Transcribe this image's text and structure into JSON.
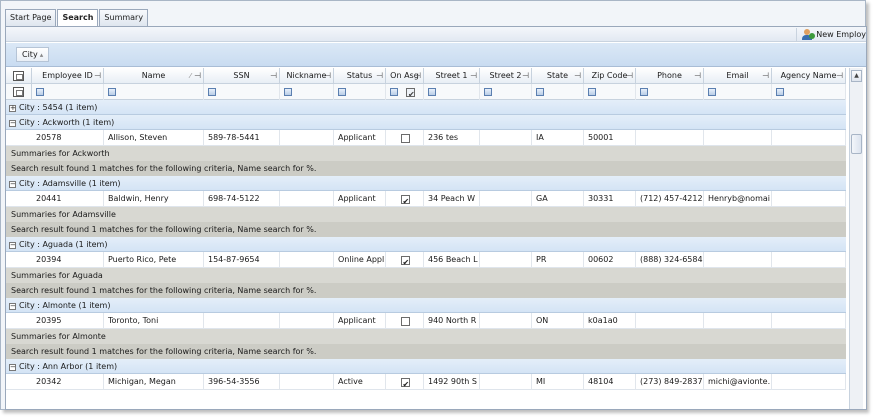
{
  "tabs": [
    {
      "label": "Start Page"
    },
    {
      "label": "Search"
    },
    {
      "label": "Summary"
    }
  ],
  "toolbar": {
    "new_employee_label": "New Employ"
  },
  "grouping": {
    "chip_label": "City",
    "sort_glyph": "▴"
  },
  "columns": {
    "employee_id": "Employee ID",
    "name": "Name",
    "ssn": "SSN",
    "nickname": "Nickname",
    "status": "Status",
    "on_asg": "On Asg",
    "street1": "Street 1",
    "street2": "Street 2",
    "state": "State",
    "zip": "Zip Code",
    "phone": "Phone",
    "email": "Email",
    "agency": "Agency Name"
  },
  "collapsed_group": {
    "label": "City : 5454 (1 item)"
  },
  "groups": [
    {
      "label": "City : Ackworth (1 item)",
      "row": {
        "employee_id": "20578",
        "name": "Allison, Steven",
        "ssn": "589-78-5441",
        "nickname": "",
        "status": "Applicant",
        "on_asg": false,
        "street1": "236 tes",
        "street2": "",
        "state": "IA",
        "zip": "50001",
        "phone": "",
        "email": "",
        "agency": ""
      },
      "summary_title": "Summaries for Ackworth",
      "summary_text": "Search result found 1 matches for the following criteria, Name search for %."
    },
    {
      "label": "City : Adamsville (1 item)",
      "row": {
        "employee_id": "20441",
        "name": "Baldwin, Henry",
        "ssn": "698-74-5122",
        "nickname": "",
        "status": "Applicant",
        "on_asg": true,
        "street1": "34 Peach W",
        "street2": "",
        "state": "GA",
        "zip": "30331",
        "phone": "(712) 457-4212",
        "email": "Henryb@nomai",
        "agency": ""
      },
      "summary_title": "Summaries for Adamsville",
      "summary_text": "Search result found 1 matches for the following criteria, Name search for %."
    },
    {
      "label": "City : Aguada (1 item)",
      "row": {
        "employee_id": "20394",
        "name": "Puerto Rico, Pete",
        "ssn": "154-87-9654",
        "nickname": "",
        "status": "Online Appl",
        "on_asg": true,
        "street1": "456 Beach L",
        "street2": "",
        "state": "PR",
        "zip": "00602",
        "phone": "(888) 324-6584",
        "email": "",
        "agency": ""
      },
      "summary_title": "Summaries for Aguada",
      "summary_text": "Search result found 1 matches for the following criteria, Name search for %."
    },
    {
      "label": "City : Almonte (1 item)",
      "row": {
        "employee_id": "20395",
        "name": "Toronto, Toni",
        "ssn": "",
        "nickname": "",
        "status": "Applicant",
        "on_asg": false,
        "street1": "940 North R",
        "street2": "",
        "state": "ON",
        "zip": "k0a1a0",
        "phone": "",
        "email": "",
        "agency": ""
      },
      "summary_title": "Summaries for Almonte",
      "summary_text": "Search result found 1 matches for the following criteria, Name search for %."
    },
    {
      "label": "City : Ann Arbor (1 item)",
      "row": {
        "employee_id": "20342",
        "name": "Michigan, Megan",
        "ssn": "396-54-3556",
        "nickname": "",
        "status": "Active",
        "on_asg": true,
        "street1": "1492 90th S",
        "street2": "",
        "state": "MI",
        "zip": "48104",
        "phone": "(273) 849-2837",
        "email": "michi@avionte.",
        "agency": ""
      }
    }
  ],
  "icons": {
    "pin": "pin-icon",
    "filter": "filter-icon",
    "row_selector": "row-selector-icon",
    "clear_filter": "clear-filter-icon",
    "new_employee": "user-add-icon",
    "expand": "expand-icon",
    "collapse": "collapse-icon"
  }
}
